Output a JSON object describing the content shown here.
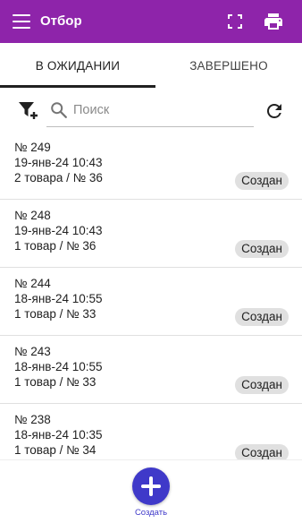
{
  "colors": {
    "appbar": "#8e24aa",
    "fab": "#3f39c9",
    "badge_bg": "#e0e0e0"
  },
  "appbar": {
    "title": "Отбор",
    "icons": [
      "menu-icon",
      "fullscreen-icon",
      "print-icon"
    ]
  },
  "tabs": [
    {
      "label": "В ОЖИДАНИИ",
      "active": true
    },
    {
      "label": "ЗАВЕРШЕНО",
      "active": false
    }
  ],
  "search": {
    "placeholder": "Поиск",
    "value": ""
  },
  "orders": [
    {
      "number": "№ 249",
      "datetime": "19-янв-24 10:43",
      "details": "2 товара / № 36",
      "status": "Создан"
    },
    {
      "number": "№ 248",
      "datetime": "19-янв-24 10:43",
      "details": "1 товар / № 36",
      "status": "Создан"
    },
    {
      "number": "№ 244",
      "datetime": "18-янв-24 10:55",
      "details": "1 товар / № 33",
      "status": "Создан"
    },
    {
      "number": "№ 243",
      "datetime": "18-янв-24 10:55",
      "details": "1 товар / № 33",
      "status": "Создан"
    },
    {
      "number": "№ 238",
      "datetime": "18-янв-24 10:35",
      "details": "1 товар / № 34",
      "status": "Создан"
    }
  ],
  "fab": {
    "label": "Создать"
  }
}
